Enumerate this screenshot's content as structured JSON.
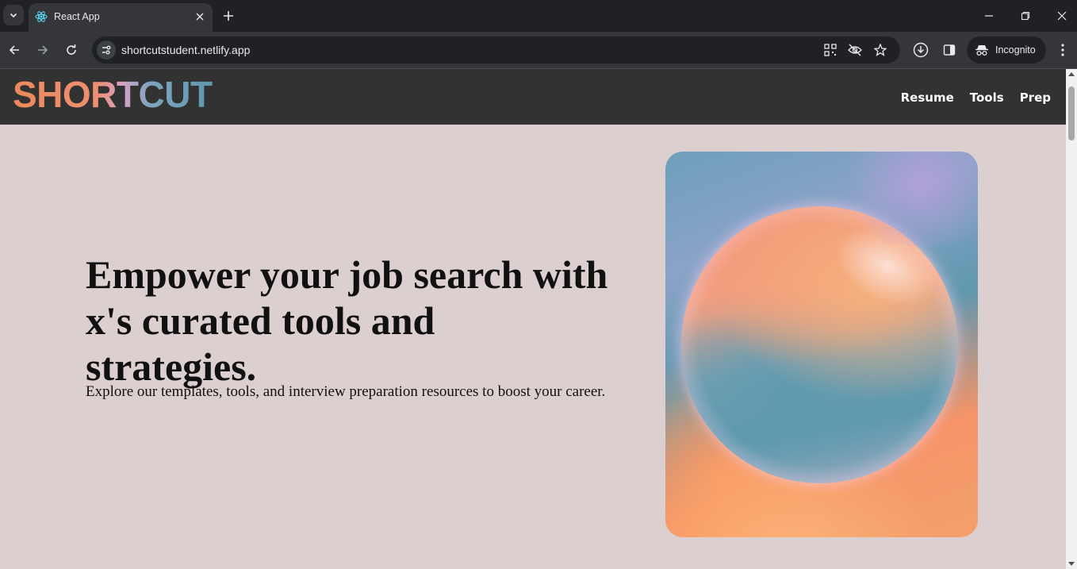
{
  "browser": {
    "tab": {
      "title": "React App",
      "favicon": "react-icon"
    },
    "omnibox": {
      "url": "shortcutstudent.netlify.app"
    },
    "profile": {
      "label": "Incognito"
    },
    "icons": [
      "tab-search-icon",
      "close-icon",
      "plus-icon",
      "minimize-icon",
      "restore-icon",
      "back-icon",
      "forward-icon",
      "reload-icon",
      "site-info-icon",
      "qr-code-icon",
      "eye-off-icon",
      "star-icon",
      "download-icon",
      "sidebar-icon",
      "incognito-icon",
      "more-vert-icon"
    ]
  },
  "site": {
    "logo": "SHORTCUT",
    "nav": [
      "Resume",
      "Tools",
      "Prep"
    ]
  },
  "hero": {
    "title": "Empower your job search with x's curated tools and strategies.",
    "subtitle": "Explore our templates, tools, and interview preparation resources to boost your career."
  }
}
